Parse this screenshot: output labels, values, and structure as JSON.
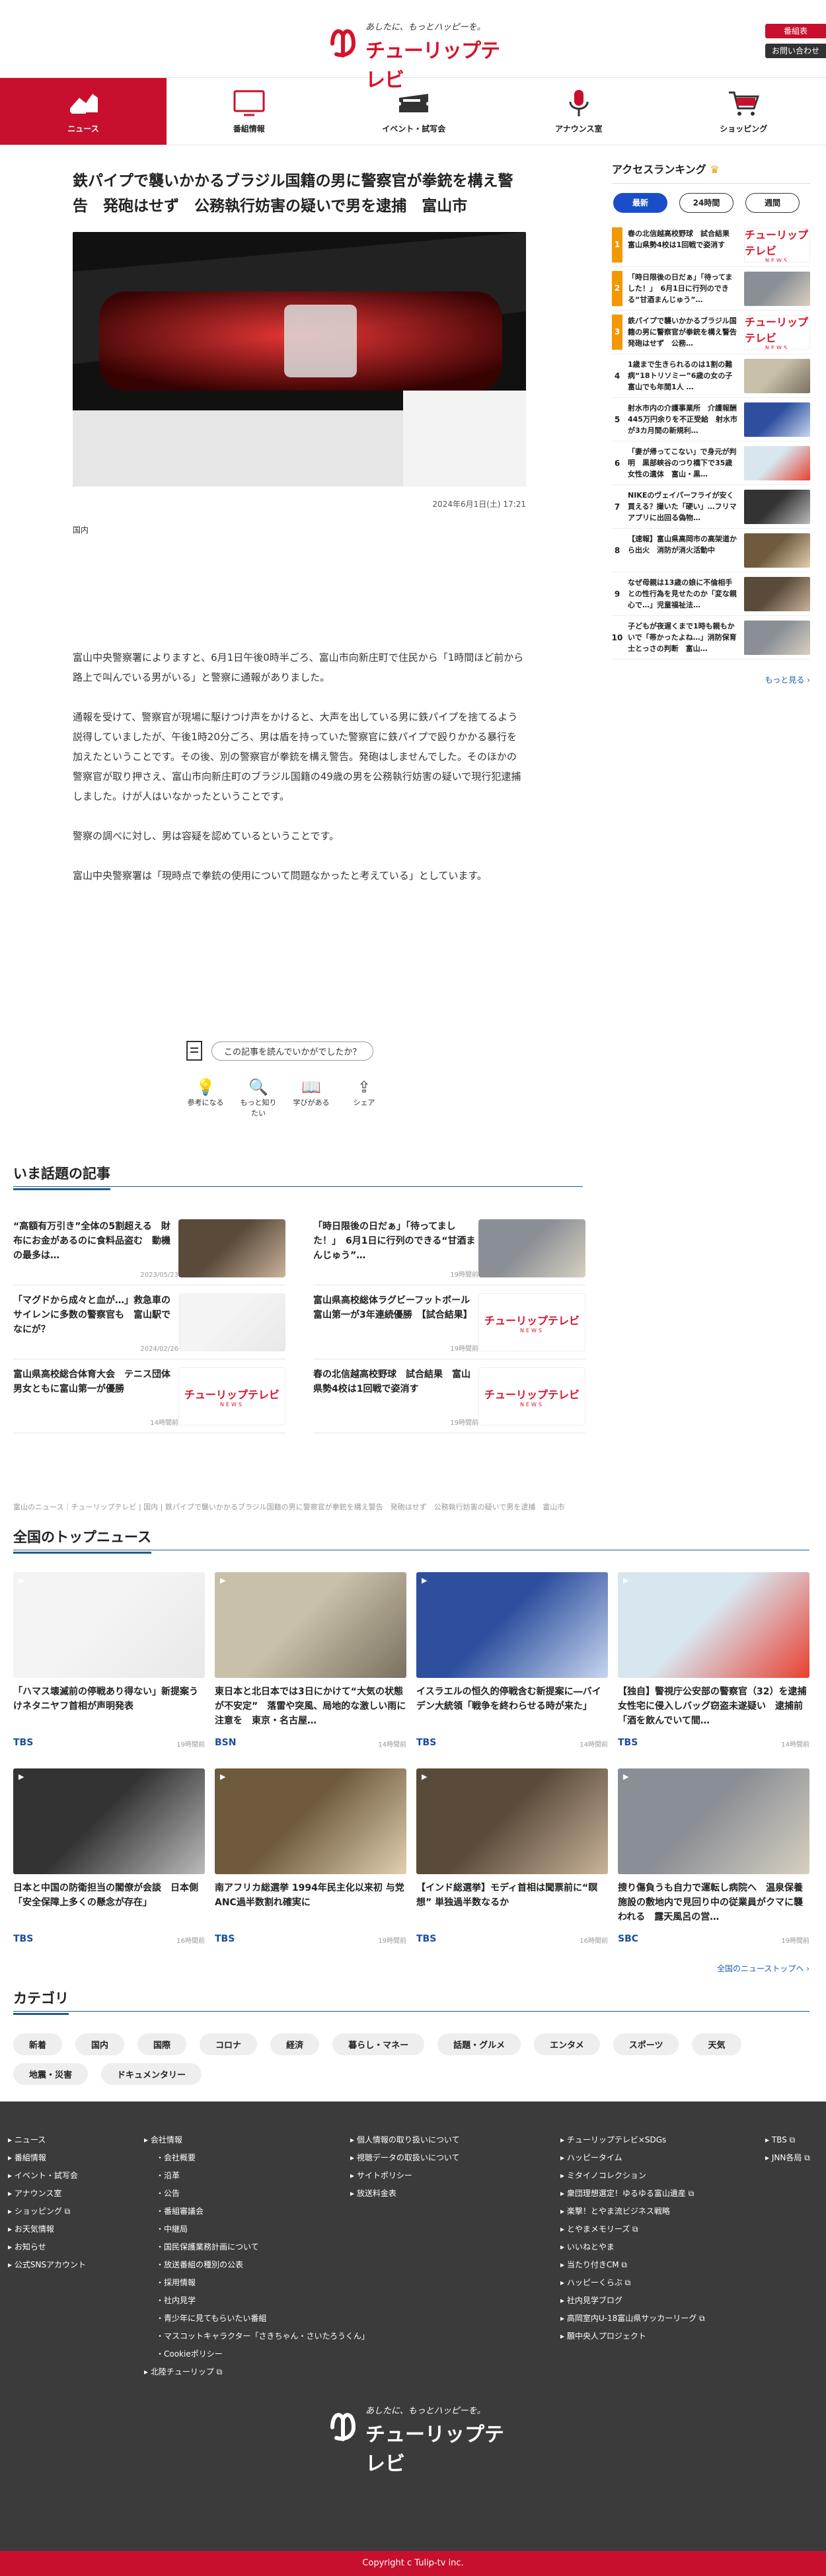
{
  "header": {
    "tagline": "あしたに、もっとハッピーを。",
    "logo": "チューリップテレビ",
    "btn_program": "番組表",
    "btn_contact": "お問い合わせ"
  },
  "nav": [
    {
      "label": "ニュース",
      "icon": "news-icon"
    },
    {
      "label": "番組情報",
      "icon": "tv-icon"
    },
    {
      "label": "イベント・試写会",
      "icon": "ticket-icon"
    },
    {
      "label": "アナウンス室",
      "icon": "microphone-icon"
    },
    {
      "label": "ショッピング",
      "icon": "cart-icon"
    }
  ],
  "article": {
    "title": "鉄パイプで襲いかかるブラジル国籍の男に警察官が拳銃を構え警告　発砲はせず　公務執行妨害の疑いで男を逮捕　富山市",
    "date": "2024年6月1日(土) 17:21",
    "category": "国内",
    "paragraphs": [
      "富山中央警察署によりますと、6月1日午後0時半ごろ、富山市向新庄町で住民から「1時間ほど前から路上で叫んでいる男がいる」と警察に通報がありました。",
      "通報を受けて、警察官が現場に駆けつけ声をかけると、大声を出している男に鉄パイプを捨てるよう説得していましたが、午後1時20分ごろ、男は盾を持っていた警察官に鉄パイプで殴りかかる暴行を加えたということです。その後、別の警察官が拳銃を構え警告。発砲はしませんでした。そのほかの警察官が取り押さえ、富山市向新庄町のブラジル国籍の49歳の男を公務執行妨害の疑いで現行犯逮捕しました。けが人はいなかったということです。",
      "警察の調べに対し、男は容疑を認めているということです。",
      "富山中央警察署は「現時点で拳銃の使用について問題なかったと考えている」としています。"
    ]
  },
  "reaction": {
    "question": "この記事を読んでいかがでしたか？",
    "options": [
      "参考になる",
      "もっと知りたい",
      "学びがある",
      "シェア"
    ]
  },
  "trending": {
    "heading": "いま話題の記事",
    "items": [
      {
        "title": "“高額有万引き”全体の5割超える　財布にお金があるのに食料品盗む　動機の最多は…",
        "date": "2023/05/23"
      },
      {
        "title": "「時日限後の日だぁ」「待ってました！」　6月1日に行列のできる“甘酒まんじゅう”…",
        "date": "19時間前"
      },
      {
        "title": "「マグドから成々と血が…」救急車のサイレンに多数の警察官も　富山駅でなにが？",
        "date": "2024/02/26"
      },
      {
        "title": "富山県高校総体ラグビーフットボール　富山第一が3年連続優勝　【試合結果】",
        "date": "19時間前"
      },
      {
        "title": "富山県高校総合体育大会　テニス団体男女ともに富山第一が優勝",
        "date": "14時間前"
      },
      {
        "title": "春の北信越高校野球　試合結果　富山県勢4校は1回戦で姿消す",
        "date": "19時間前"
      }
    ]
  },
  "breadcrumb": "富山のニュース｜チューリップテレビ | 国内 | 鉄パイプで襲いかかるブラジル国籍の男に警察官が拳銃を構え警告　発砲はせず　公務執行妨害の疑いで男を逮捕　富山市",
  "top_news": {
    "heading": "全国のトップニュース",
    "more": "全国のニューストップへ ›",
    "items": [
      {
        "title": "「ハマス壊滅前の停戦あり得ない」新提案うけネタニヤフ首相が声明発表",
        "source": "TBS",
        "time": "19時間前"
      },
      {
        "title": "東日本と北日本では3日にかけて“大気の状態が不安定”　落雷や突風、局地的な激しい雨に注意を　東京・名古屋…",
        "source": "BSN",
        "time": "14時間前"
      },
      {
        "title": "イスラエルの恒久的停戦含む新提案に―バイデン大統領「戦争を終わらせる時が来た」",
        "source": "TBS",
        "time": "14時間前"
      },
      {
        "title": "【独自】警視庁公安部の警察官（32）を逮捕　女性宅に侵入しバッグ窃盗未遂疑い　逮捕前「酒を飲んでいて間…",
        "source": "TBS",
        "time": "14時間前"
      },
      {
        "title": "日本と中国の防衛担当の閣僚が会談　日本側「安全保障上多くの懸念が存在」",
        "source": "TBS",
        "time": "16時間前"
      },
      {
        "title": "南アフリカ総選挙 1994年民主化以来初 与党ANC過半数割れ確実に",
        "source": "TBS",
        "time": "19時間前"
      },
      {
        "title": "【インド総選挙】モディ首相は聞票前に“瞑想” 単独過半数なるか",
        "source": "TBS",
        "time": "16時間前"
      },
      {
        "title": "捜り傷負うも自力で運転し病院へ　温泉保養施設の敷地内で見回り中の従業員がクマに襲われる　露天風呂の営…",
        "source": "SBC",
        "time": "19時間前"
      }
    ]
  },
  "sidebar": {
    "heading": "アクセスランキング",
    "tabs": [
      "最新",
      "24時間",
      "週間"
    ],
    "more": "もっと見る ›",
    "items": [
      {
        "title": "春の北信越高校野球　試合結果　富山県勢4校は1回戦で姿消す"
      },
      {
        "title": "「時日限後の日だぁ」「待ってました！」　6月1日に行列のできる“甘酒まんじゅう”…"
      },
      {
        "title": "鉄パイプで襲いかかるブラジル国籍の男に警察官が拳銃を構え警告　発砲はせず　公務…"
      },
      {
        "title": "1歳まで生きられるのは1割の難病“18トリソミー”6歳の女の子　富山でも年間1人 …"
      },
      {
        "title": "射水市内の介護事業所　介護報酬445万円余りを不正受給　射水市が3カ月間の新規利…"
      },
      {
        "title": "「妻が帰ってこない」で身元が判明　黒部峡谷のつり橋下で35歳女性の遺体　富山・黒…"
      },
      {
        "title": "NIKEのヴェイパーフライが安く買える？撮いた「硬い」…フリマアプリに出回る偽物…"
      },
      {
        "title": "【速報】富山県高岡市の高架道から出火　消防が消火活動中"
      },
      {
        "title": "なぜ母親は13歳の娘に不倫相手との性行為を見せたのか「変な親心で…」児童福祉法…"
      },
      {
        "title": "子どもが夜遅くまで1時も親もかいで「帯かったよね…」消防保育士とっさの判断　富山…"
      }
    ]
  },
  "categories": {
    "heading": "カテゴリ",
    "items": [
      "新着",
      "国内",
      "国際",
      "コロナ",
      "経済",
      "暮らし・マネー",
      "話題・グルメ",
      "エンタメ",
      "スポーツ",
      "天気",
      "地震・災害",
      "ドキュメンタリー"
    ]
  },
  "footer": {
    "col1": [
      "ニュース",
      "番組情報",
      "イベント・試写会",
      "アナウンス室",
      "ショッピング ⧉",
      "お天気情報",
      "お知らせ",
      "公式SNSアカウント"
    ],
    "col2_head": "会社情報",
    "col2": [
      "会社概要",
      "沿革",
      "公告",
      "番組審議会",
      "中継局",
      "国民保護業務計画について",
      "放送番組の種別の公表",
      "採用情報",
      "社内見学",
      "青少年に見てもらいたい番組",
      "マスコットキャラクター「さきちゃん・さいたろうくん」",
      "Cookieポリシー"
    ],
    "col2_tail": "北陸チューリップ ⧉",
    "col3": [
      "個人情報の取り扱いについて",
      "視聴データの取扱いについて",
      "サイトポリシー",
      "放送料金表"
    ],
    "col4": [
      "チューリップテレビ×SDGs",
      "ハッピータイム",
      "ミタイノコレクション",
      "衆団理想選定！ゆるゆる富山遺産 ⧉",
      "楽撃！とやま流ビジネス戦略",
      "とやまメモリーズ ⧉",
      "いいねとやま",
      "当たり付きCM ⧉",
      "ハッピーくらぶ ⧉",
      "社内見学ブログ",
      "高岡室内U-18富山県サッカーリーグ ⧉",
      "願中央人プロジェクト"
    ],
    "col5": [
      "TBS ⧉",
      "JNN各局 ⧉"
    ],
    "copyright": "Copyright c Tulip-tv inc."
  },
  "colors": {
    "brand_red": "#c8102e",
    "accent_blue": "#1a4ec9",
    "rank_orange": "#f39800",
    "footer_bg": "#3b3b3b"
  }
}
